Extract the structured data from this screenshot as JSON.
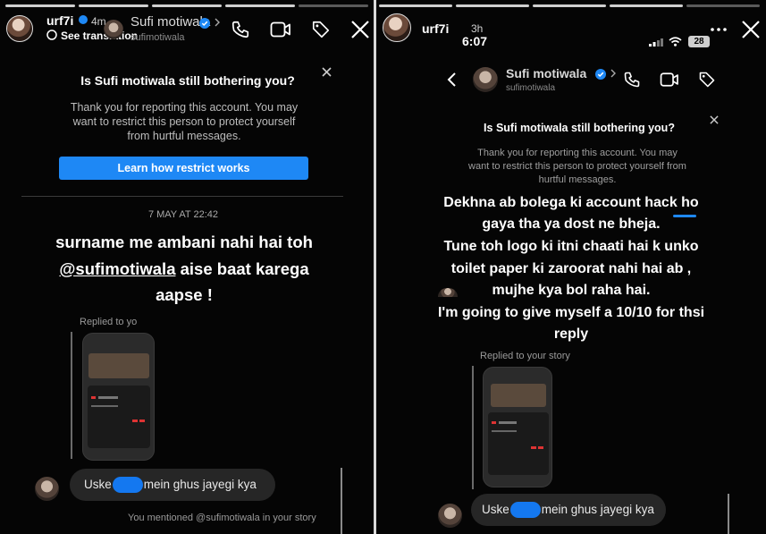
{
  "left": {
    "username": "urf7i",
    "time": "4m",
    "see_translation": "See translation",
    "dm_name": "Sufi motiwala",
    "dm_handle": "sufimotiwala",
    "card": {
      "title": "Is Sufi motiwala still bothering you?",
      "body": "Thank you for reporting this account. You may want to restrict this person to protect yourself from hurtful messages.",
      "button": "Learn how restrict works"
    },
    "date": "7 MAY AT 22:42",
    "caption_line1": "surname me ambani nahi hai toh",
    "caption_mention": "@sufimotiwala",
    "caption_line2_rest": " aise baat karega",
    "caption_line3": "aapse !",
    "replied_label": "Replied to yo",
    "bubble_before": "Uske",
    "bubble_after": "mein ghus jayegi kya",
    "mentioned": "You mentioned @sufimotiwala in your story"
  },
  "right": {
    "username": "urf7i",
    "time": "3h",
    "clock": "6:07",
    "battery": "28",
    "dm_name": "Sufi motiwala",
    "dm_handle": "sufimotiwala",
    "card": {
      "title": "Is Sufi motiwala still bothering you?",
      "body": "Thank you for reporting this account. You may want to restrict this person to protect yourself from hurtful messages."
    },
    "caption": [
      "Dekhna ab bolega ki account hack ho",
      "gaya tha ya dost ne bheja.",
      "Tune toh logo ki itni chaati hai k unko",
      "toilet paper ki zaroorat nahi hai ab ,",
      "mujhe kya bol raha hai.",
      "I'm going to give myself a 10/10 for thsi",
      "reply"
    ],
    "replied_label": "Replied to your story",
    "bubble_before": "Uske",
    "bubble_after": "mein ghus jayegi kya"
  },
  "colors": {
    "accent": "#1e88f5",
    "highlight_blob": "#1478f0",
    "bubble": "#262626",
    "background": "#050505"
  }
}
